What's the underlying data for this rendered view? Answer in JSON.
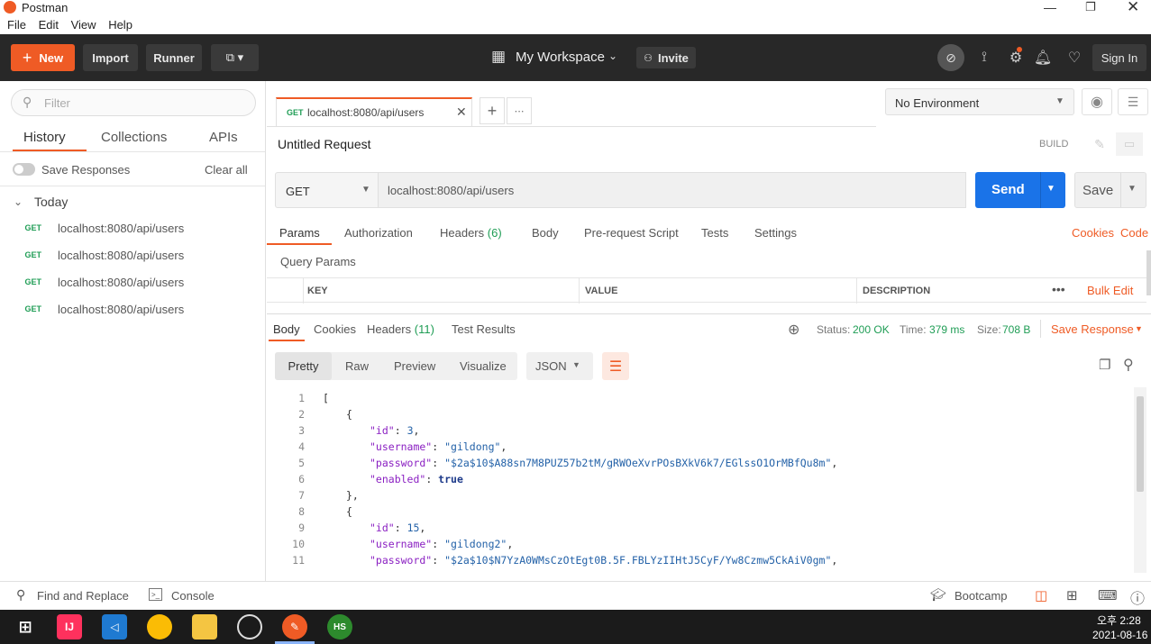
{
  "window": {
    "title": "Postman",
    "menu": [
      "File",
      "Edit",
      "View",
      "Help"
    ]
  },
  "header": {
    "new_label": "New",
    "import_label": "Import",
    "runner_label": "Runner",
    "workspace_label": "My Workspace",
    "invite_label": "Invite",
    "signin_label": "Sign In"
  },
  "sidebar": {
    "filter_placeholder": "Filter",
    "tabs": [
      "History",
      "Collections",
      "APIs"
    ],
    "save_responses_label": "Save Responses",
    "clear_all_label": "Clear all",
    "group_label": "Today",
    "history": [
      {
        "method": "GET",
        "url": "localhost:8080/api/users"
      },
      {
        "method": "GET",
        "url": "localhost:8080/api/users"
      },
      {
        "method": "GET",
        "url": "localhost:8080/api/users"
      },
      {
        "method": "GET",
        "url": "localhost:8080/api/users"
      }
    ]
  },
  "request_tab": {
    "method": "GET",
    "url": "localhost:8080/api/users"
  },
  "environment": {
    "selected": "No Environment"
  },
  "request": {
    "title": "Untitled Request",
    "build_label": "BUILD",
    "method": "GET",
    "url": "localhost:8080/api/users",
    "send_label": "Send",
    "save_label": "Save"
  },
  "request_tabs": {
    "params": "Params",
    "authorization": "Authorization",
    "headers": "Headers",
    "headers_count": "(6)",
    "body": "Body",
    "prerequest": "Pre-request Script",
    "tests": "Tests",
    "settings": "Settings",
    "cookies": "Cookies",
    "code": "Code"
  },
  "query_params": {
    "title": "Query Params",
    "columns": [
      "KEY",
      "VALUE",
      "DESCRIPTION"
    ],
    "bulk_edit": "Bulk Edit"
  },
  "response": {
    "tabs": {
      "body": "Body",
      "cookies": "Cookies",
      "headers": "Headers",
      "headers_count": "(11)",
      "test_results": "Test Results"
    },
    "status_label": "Status:",
    "status_value": "200 OK",
    "time_label": "Time:",
    "time_value": "379 ms",
    "size_label": "Size:",
    "size_value": "708 B",
    "save_response": "Save Response",
    "view_modes": [
      "Pretty",
      "Raw",
      "Preview",
      "Visualize"
    ],
    "format": "JSON",
    "lines": [
      {
        "n": "1",
        "indent": 0,
        "parts": [
          [
            "punc",
            "["
          ]
        ]
      },
      {
        "n": "2",
        "indent": 1,
        "parts": [
          [
            "punc",
            "{"
          ]
        ]
      },
      {
        "n": "3",
        "indent": 2,
        "parts": [
          [
            "key",
            "\"id\""
          ],
          [
            "punc",
            ": "
          ],
          [
            "str",
            "3"
          ],
          [
            "punc",
            ","
          ]
        ]
      },
      {
        "n": "4",
        "indent": 2,
        "parts": [
          [
            "key",
            "\"username\""
          ],
          [
            "punc",
            ": "
          ],
          [
            "str",
            "\"gildong\""
          ],
          [
            "punc",
            ","
          ]
        ]
      },
      {
        "n": "5",
        "indent": 2,
        "parts": [
          [
            "key",
            "\"password\""
          ],
          [
            "punc",
            ": "
          ],
          [
            "str",
            "\"$2a$10$A88sn7M8PUZ57b2tM/gRWOeXvrPOsBXkV6k7/EGlssO1OrMBfQu8m\""
          ],
          [
            "punc",
            ","
          ]
        ]
      },
      {
        "n": "6",
        "indent": 2,
        "parts": [
          [
            "key",
            "\"enabled\""
          ],
          [
            "punc",
            ": "
          ],
          [
            "bool",
            "true"
          ]
        ]
      },
      {
        "n": "7",
        "indent": 1,
        "parts": [
          [
            "punc",
            "},"
          ]
        ]
      },
      {
        "n": "8",
        "indent": 1,
        "parts": [
          [
            "punc",
            "{"
          ]
        ]
      },
      {
        "n": "9",
        "indent": 2,
        "parts": [
          [
            "key",
            "\"id\""
          ],
          [
            "punc",
            ": "
          ],
          [
            "str",
            "15"
          ],
          [
            "punc",
            ","
          ]
        ]
      },
      {
        "n": "10",
        "indent": 2,
        "parts": [
          [
            "key",
            "\"username\""
          ],
          [
            "punc",
            ": "
          ],
          [
            "str",
            "\"gildong2\""
          ],
          [
            "punc",
            ","
          ]
        ]
      },
      {
        "n": "11",
        "indent": 2,
        "parts": [
          [
            "key",
            "\"password\""
          ],
          [
            "punc",
            ": "
          ],
          [
            "str",
            "\"$2a$10$N7YzA0WMsCzOtEgt0B.5F.FBLYzIIHtJ5CyF/Yw8Czmw5CkAiV0gm\""
          ],
          [
            "punc",
            ","
          ]
        ]
      }
    ]
  },
  "footer": {
    "find_replace": "Find and Replace",
    "console": "Console",
    "bootcamp": "Bootcamp"
  },
  "taskbar": {
    "time": "오후 2:28",
    "date": "2021-08-16"
  },
  "colors": {
    "accent": "#ef5b25",
    "send": "#1a73e8",
    "header_bg": "#282828",
    "status_ok": "#1f9d55"
  }
}
